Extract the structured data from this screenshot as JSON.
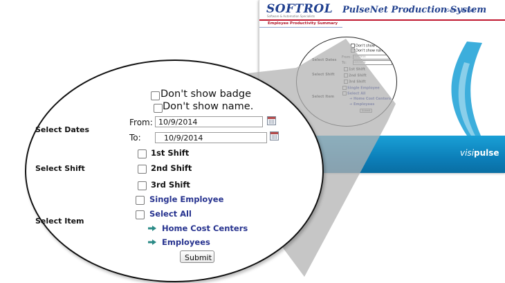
{
  "app": {
    "logo": "SOFTROL",
    "logo_sub": "Software & Automation Specialists",
    "system_name": "PulseNet Production System",
    "user_link": "Gene Lea Del",
    "page_title": "Employee Productivity Summary",
    "footer_brand": "visi",
    "footer_brand_bold": "pulse"
  },
  "form": {
    "dont_show_badge": "Don't show badge",
    "dont_show_name": "Don't show name.",
    "select_dates_label": "Select Dates",
    "from_label": "From:",
    "from_value": "10/9/2014",
    "to_label": "To:",
    "to_value": "10/9/2014",
    "select_shift_label": "Select Shift",
    "shift_1": "1st Shift",
    "shift_2": "2nd Shift",
    "shift_3": "3rd Shift",
    "single_employee": "Single Employee",
    "select_all": "Select All",
    "select_item_label": "Select Item",
    "home_cost_centers": "Home Cost Centers",
    "employees": "Employees",
    "submit_label": "Submit"
  },
  "colors": {
    "brand_blue": "#1f3f8f",
    "link_blue": "#27338f",
    "title_red": "#b01428",
    "footer_blue": "#0c7fb9",
    "arrow_teal": "#2a8a86"
  }
}
